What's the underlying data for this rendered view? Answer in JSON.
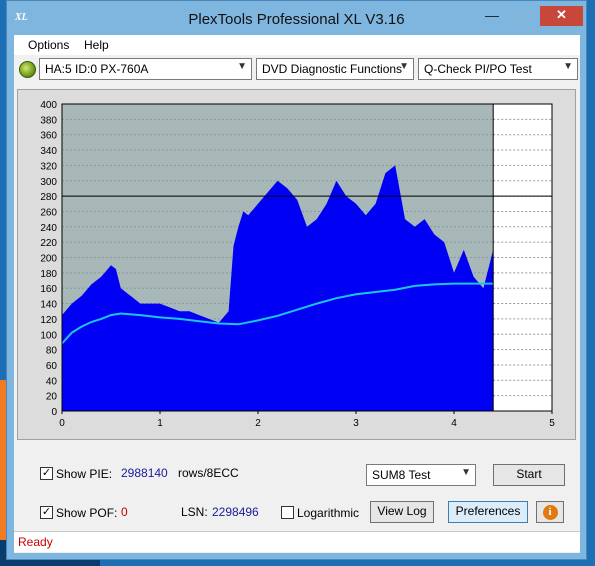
{
  "window": {
    "title": "PlexTools Professional XL V3.16",
    "icon_text": "XL",
    "minimize": "—",
    "maximize": "□",
    "close": "✕"
  },
  "menu": {
    "items": [
      "Options",
      "Help"
    ]
  },
  "toolbar": {
    "drive": "HA:5 ID:0  PX-760A",
    "function": "DVD Diagnostic Functions",
    "test": "Q-Check PI/PO Test"
  },
  "chart_data": {
    "type": "area",
    "x_ticks": [
      "0",
      "1",
      "2",
      "3",
      "4",
      "5"
    ],
    "y_ticks": [
      "0",
      "20",
      "40",
      "60",
      "80",
      "100",
      "120",
      "140",
      "160",
      "180",
      "200",
      "220",
      "240",
      "260",
      "280",
      "300",
      "320",
      "340",
      "360",
      "380",
      "400"
    ],
    "xlim": [
      0,
      5
    ],
    "ylim": [
      0,
      400
    ],
    "threshold_y": 280,
    "end_x": 4.4,
    "colors": {
      "pie_fill": "#0000f5",
      "trend": "#1ac6ef",
      "background": "#a8b8b8",
      "empty": "#ffffff"
    },
    "series": [
      {
        "x": [
          0,
          0.1,
          0.2,
          0.3,
          0.4,
          0.5,
          0.55,
          0.6,
          0.7,
          0.8,
          0.9,
          1.0,
          1.1,
          1.2,
          1.3,
          1.4,
          1.5,
          1.6,
          1.7,
          1.75,
          1.8,
          1.85,
          1.9,
          2.0,
          2.1,
          2.2,
          2.3,
          2.4,
          2.5,
          2.6,
          2.7,
          2.8,
          2.9,
          3.0,
          3.1,
          3.2,
          3.3,
          3.4,
          3.5,
          3.6,
          3.7,
          3.8,
          3.9,
          4.0,
          4.1,
          4.2,
          4.3,
          4.4
        ],
        "values": [
          125,
          140,
          150,
          165,
          175,
          190,
          185,
          160,
          150,
          140,
          140,
          140,
          135,
          130,
          130,
          125,
          120,
          115,
          130,
          215,
          240,
          260,
          255,
          270,
          285,
          300,
          290,
          275,
          240,
          250,
          270,
          300,
          280,
          270,
          255,
          270,
          310,
          320,
          250,
          240,
          250,
          230,
          220,
          180,
          210,
          175,
          160,
          210
        ]
      },
      {
        "x": [
          0,
          0.1,
          0.2,
          0.3,
          0.4,
          0.5,
          0.6,
          0.8,
          1.0,
          1.2,
          1.4,
          1.6,
          1.8,
          2.0,
          2.2,
          2.4,
          2.6,
          2.8,
          3.0,
          3.2,
          3.4,
          3.6,
          3.8,
          4.0,
          4.2,
          4.4
        ],
        "values": [
          88,
          102,
          110,
          116,
          120,
          125,
          127,
          125,
          122,
          120,
          117,
          114,
          113,
          118,
          124,
          132,
          140,
          147,
          152,
          155,
          158,
          163,
          165,
          166,
          166,
          166
        ]
      }
    ]
  },
  "controls": {
    "show_pie_label": "Show PIE:",
    "pie_value": "2988140",
    "rows_unit": "rows/8ECC",
    "show_pof_label": "Show POF:",
    "pof_value": "0",
    "lsn_label": "LSN:",
    "lsn_value": "2298496",
    "logarithmic_label": "Logarithmic",
    "sum_select": "SUM8 Test",
    "start_label": "Start",
    "view_log_label": "View Log",
    "preferences_label": "Preferences",
    "info_glyph": "i",
    "check_mark": "✓",
    "arrow": "▼"
  },
  "status": {
    "text": "Ready"
  }
}
